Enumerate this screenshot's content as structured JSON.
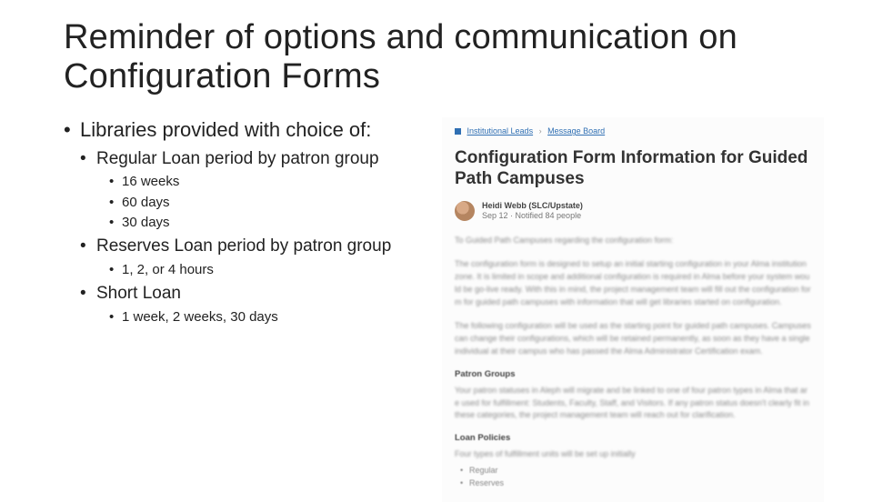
{
  "title": "Reminder of options and communication on Configuration Forms",
  "left": {
    "intro": "Libraries provided with choice of:",
    "items": [
      {
        "label": "Regular Loan period by patron group",
        "sub": [
          "16 weeks",
          "60 days",
          "30 days"
        ]
      },
      {
        "label": "Reserves Loan period by patron group",
        "sub": [
          "1, 2, or 4 hours"
        ]
      },
      {
        "label": "Short Loan",
        "sub": [
          "1 week, 2 weeks, 30 days"
        ]
      }
    ]
  },
  "panel": {
    "crumb1": "Institutional Leads",
    "crumbSep": "›",
    "crumb2": "Message Board",
    "title": "Configuration Form Information for Guided Path Campuses",
    "author": "Heidi Webb (SLC/Upstate)",
    "dateline": "Sep 12 · Notified 84 people",
    "para1": "To Guided Path Campuses regarding the configuration form:",
    "para2": "The configuration form is designed to setup an initial starting configuration in your Alma institution zone. It is limited in scope and additional configuration is required in Alma before your system would be go-live ready. With this in mind, the project management team will fill out the configuration form for guided path campuses with information that will get libraries started on configuration.",
    "para3": "The following configuration will be used as the starting point for guided path campuses. Campuses can change their configurations, which will be retained permanently, as soon as they have a single individual at their campus who has passed the Alma Administrator Certification exam.",
    "sub1": "Patron Groups",
    "para4": "Your patron statuses in Aleph will migrate and be linked to one of four patron types in Alma that are used for fulfillment: Students, Faculty, Staff, and Visitors. If any patron status doesn't clearly fit in these categories, the project management team will reach out for clarification.",
    "sub2": "Loan Policies",
    "para5": "Four types of fulfillment units will be set up initially",
    "mini": [
      "Regular",
      "Reserves"
    ]
  }
}
